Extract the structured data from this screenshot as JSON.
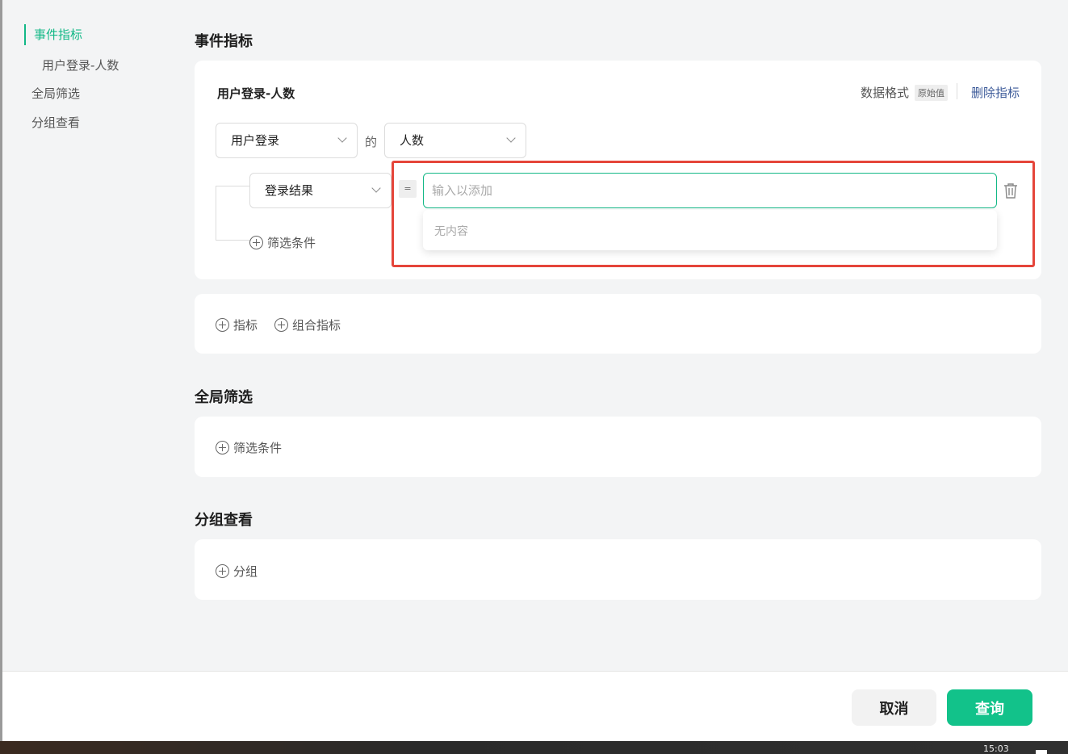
{
  "sidebar": {
    "items": [
      {
        "label": "事件指标"
      },
      {
        "label": "用户登录-人数"
      },
      {
        "label": "全局筛选"
      },
      {
        "label": "分组查看"
      }
    ]
  },
  "sections": {
    "event_metrics": "事件指标",
    "global_filter": "全局筛选",
    "group_view": "分组查看"
  },
  "metric": {
    "title": "用户登录-人数",
    "data_format_label": "数据格式",
    "data_format_value": "原始值",
    "delete_label": "删除指标",
    "event_select": "用户登录",
    "of_label": "的",
    "measure_select": "人数",
    "filter_property": "登录结果",
    "operator": "=",
    "value_placeholder": "输入以添加",
    "value": "",
    "dropdown_empty": "无内容",
    "add_filter_label": "筛选条件"
  },
  "add_metric": {
    "metric_label": "指标",
    "combined_label": "组合指标"
  },
  "global_filter": {
    "add_filter_label": "筛选条件"
  },
  "group": {
    "add_group_label": "分组"
  },
  "footer": {
    "cancel": "取消",
    "query": "查询"
  },
  "taskbar": {
    "time": "15:03"
  },
  "colors": {
    "accent": "#12b886",
    "primary_button": "#12c28a",
    "highlight": "#e5453a",
    "link": "#3c5a99"
  }
}
